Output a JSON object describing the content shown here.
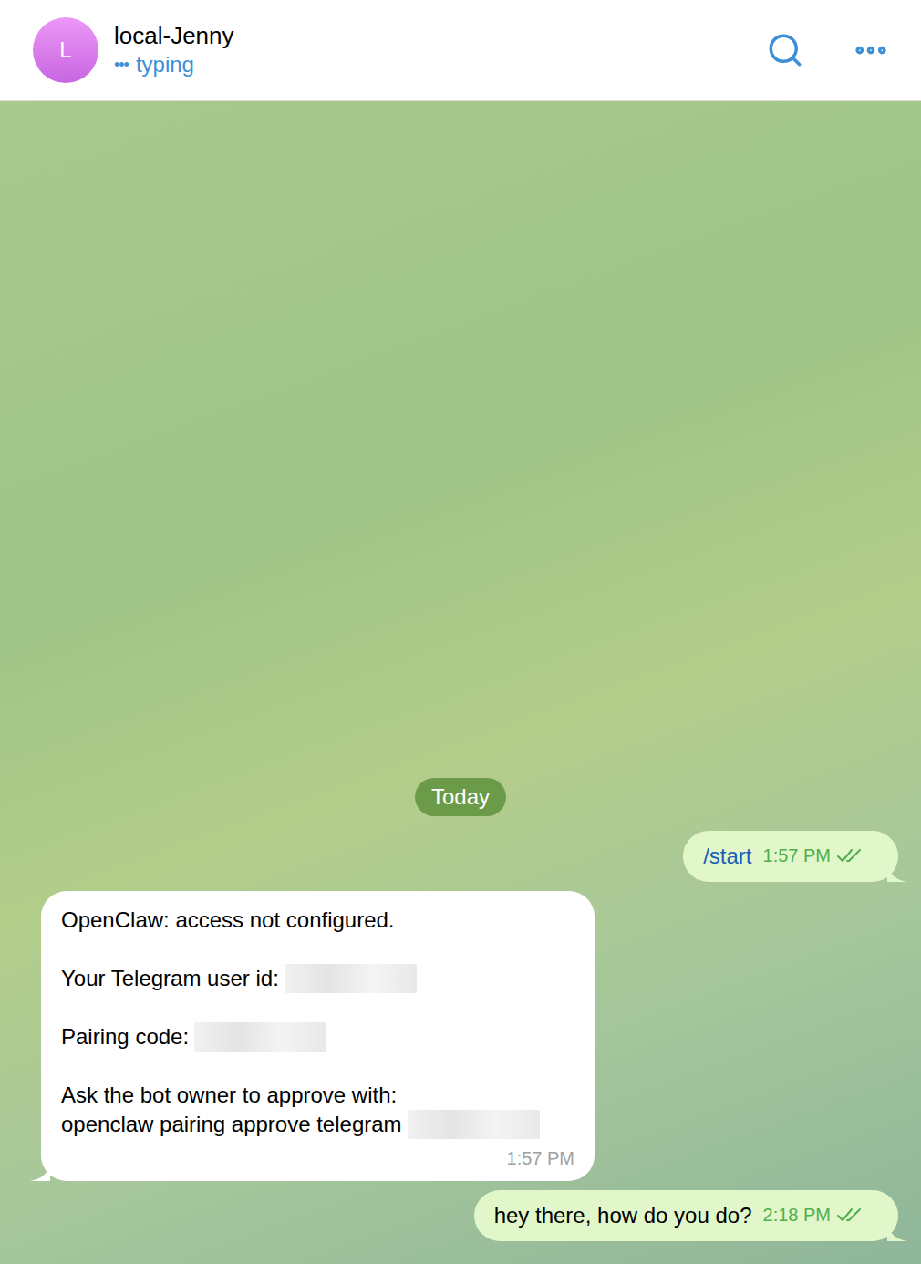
{
  "header": {
    "avatar_letter": "L",
    "title": "local-Jenny",
    "status_dots": "•••",
    "status": "typing"
  },
  "date_divider": "Today",
  "messages": [
    {
      "direction": "outgoing",
      "is_command": true,
      "read": true,
      "time": "1:57 PM",
      "paragraphs": [
        {
          "lines": [
            {
              "text": "/start",
              "redacted": false
            }
          ]
        }
      ]
    },
    {
      "direction": "incoming",
      "is_command": false,
      "read": false,
      "time": "1:57 PM",
      "paragraphs": [
        {
          "lines": [
            {
              "text": "OpenClaw: access not configured.",
              "redacted": false
            }
          ]
        },
        {
          "lines": [
            {
              "text": "Your Telegram user id:",
              "redacted": true
            }
          ]
        },
        {
          "lines": [
            {
              "text": "Pairing code:",
              "redacted": true
            }
          ]
        },
        {
          "lines": [
            {
              "text": "Ask the bot owner to approve with:",
              "redacted": false
            },
            {
              "text": "openclaw pairing approve telegram",
              "redacted": true
            }
          ]
        }
      ]
    },
    {
      "direction": "outgoing",
      "is_command": false,
      "read": true,
      "time": "2:18 PM",
      "paragraphs": [
        {
          "lines": [
            {
              "text": "hey there, how do you do?",
              "redacted": false
            }
          ]
        }
      ]
    }
  ]
}
